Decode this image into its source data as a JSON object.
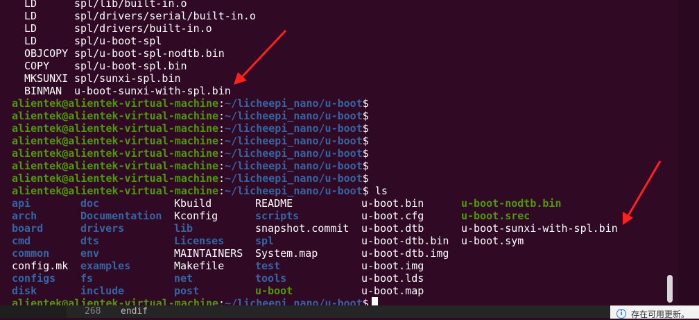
{
  "build_lines": [
    {
      "cmd": "LD",
      "target": "spl/lib/built-in.o"
    },
    {
      "cmd": "LD",
      "target": "spl/drivers/serial/built-in.o"
    },
    {
      "cmd": "LD",
      "target": "spl/drivers/built-in.o"
    },
    {
      "cmd": "LD",
      "target": "spl/u-boot-spl"
    },
    {
      "cmd": "OBJCOPY",
      "target": "spl/u-boot-spl-nodtb.bin"
    },
    {
      "cmd": "COPY",
      "target": "spl/u-boot-spl.bin"
    },
    {
      "cmd": "MKSUNXI",
      "target": "spl/sunxi-spl.bin"
    },
    {
      "cmd": "BINMAN",
      "target": "u-boot-sunxi-with-spl.bin"
    }
  ],
  "prompt": {
    "user_host": "alientek@alientek-virtual-machine",
    "colon": ":",
    "path": "~/licheepi_nano/u-boot",
    "dollar": "$"
  },
  "ls_command": " ls",
  "ls_columns": [
    [
      {
        "name": "api",
        "type": "dir"
      },
      {
        "name": "arch",
        "type": "dir"
      },
      {
        "name": "board",
        "type": "dir"
      },
      {
        "name": "cmd",
        "type": "dir"
      },
      {
        "name": "common",
        "type": "dir"
      },
      {
        "name": "config.mk",
        "type": "file"
      },
      {
        "name": "configs",
        "type": "dir"
      },
      {
        "name": "disk",
        "type": "dir"
      }
    ],
    [
      {
        "name": "doc",
        "type": "dir"
      },
      {
        "name": "Documentation",
        "type": "dir"
      },
      {
        "name": "drivers",
        "type": "dir"
      },
      {
        "name": "dts",
        "type": "dir"
      },
      {
        "name": "env",
        "type": "dir"
      },
      {
        "name": "examples",
        "type": "dir"
      },
      {
        "name": "fs",
        "type": "dir"
      },
      {
        "name": "include",
        "type": "dir"
      }
    ],
    [
      {
        "name": "Kbuild",
        "type": "file"
      },
      {
        "name": "Kconfig",
        "type": "file"
      },
      {
        "name": "lib",
        "type": "dir"
      },
      {
        "name": "Licenses",
        "type": "dir"
      },
      {
        "name": "MAINTAINERS",
        "type": "file"
      },
      {
        "name": "Makefile",
        "type": "file"
      },
      {
        "name": "net",
        "type": "dir"
      },
      {
        "name": "post",
        "type": "dir"
      }
    ],
    [
      {
        "name": "README",
        "type": "file"
      },
      {
        "name": "scripts",
        "type": "dir"
      },
      {
        "name": "snapshot.commit",
        "type": "file"
      },
      {
        "name": "spl",
        "type": "dir"
      },
      {
        "name": "System.map",
        "type": "file"
      },
      {
        "name": "test",
        "type": "dir"
      },
      {
        "name": "tools",
        "type": "dir"
      },
      {
        "name": "u-boot",
        "type": "exec"
      }
    ],
    [
      {
        "name": "u-boot.bin",
        "type": "file"
      },
      {
        "name": "u-boot.cfg",
        "type": "file"
      },
      {
        "name": "u-boot.dtb",
        "type": "file"
      },
      {
        "name": "u-boot-dtb.bin",
        "type": "file"
      },
      {
        "name": "u-boot-dtb.img",
        "type": "file"
      },
      {
        "name": "u-boot.img",
        "type": "file"
      },
      {
        "name": "u-boot.lds",
        "type": "file"
      },
      {
        "name": "u-boot.map",
        "type": "file"
      }
    ],
    [
      {
        "name": "u-boot-nodtb.bin",
        "type": "exec"
      },
      {
        "name": "u-boot.srec",
        "type": "exec"
      },
      {
        "name": "u-boot-sunxi-with-spl.bin",
        "type": "file"
      },
      {
        "name": "u-boot.sym",
        "type": "file"
      }
    ]
  ],
  "colors": {
    "background": "#300a24",
    "prompt_green": "#4e9a06",
    "path_blue": "#3465a4",
    "dir_blue": "#3465a4",
    "exec_green": "#4e9a06",
    "arrow_red": "#ff2020"
  },
  "editor_strip": {
    "line_number": "268",
    "code": "endif"
  },
  "notification": {
    "icon": "info-icon",
    "text": "存在可用更新。"
  }
}
